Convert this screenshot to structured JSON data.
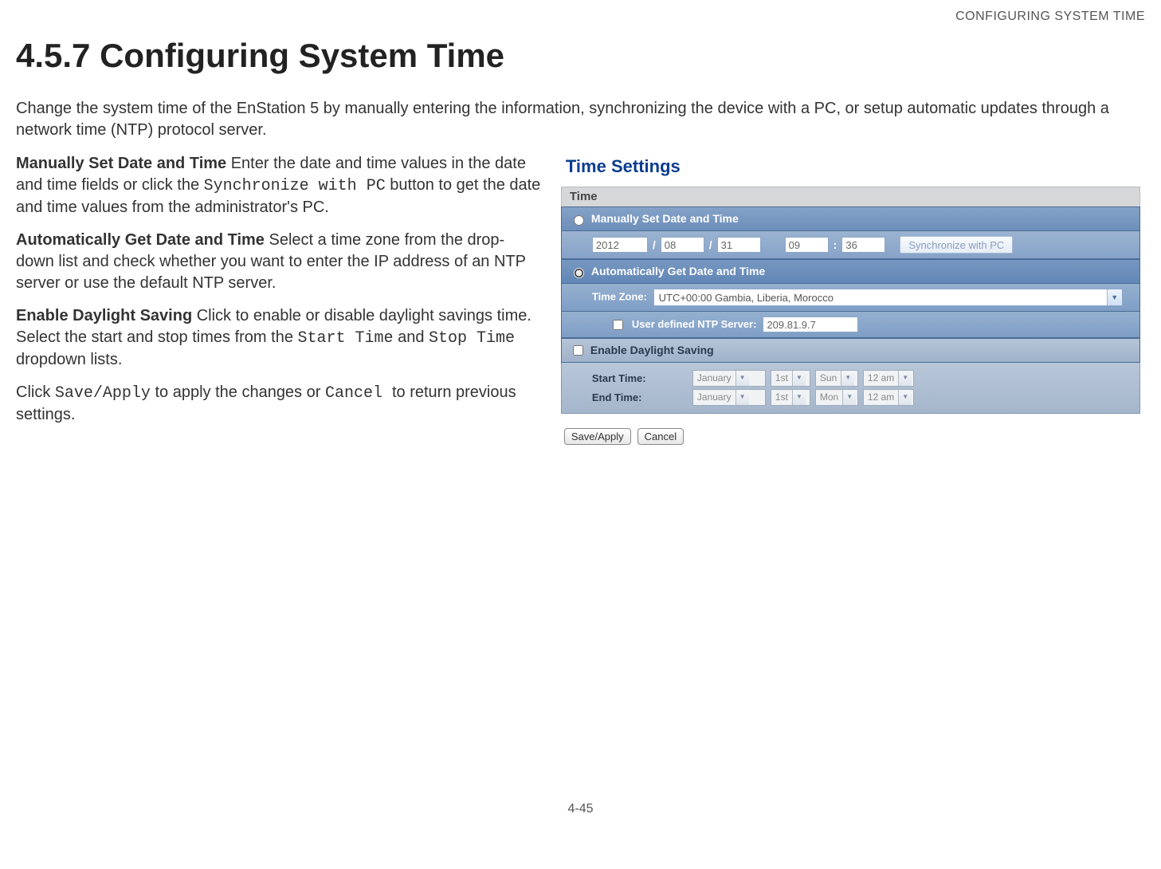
{
  "running_header": "CONFIGURING SYSTEM TIME",
  "section_number_title": "4.5.7 Configuring System Time",
  "intro": "Change the system time of the EnStation 5 by manually entering the information, synchronizing the device with a PC, or setup automatic updates through a network time (NTP) protocol server.",
  "p1": {
    "lead": "Manually Set Date and Time",
    "a": "  Enter the date and time values in the date and time fields or click the ",
    "code": "Synchronize with PC",
    "b": " button to get the date and time values from the administrator's PC."
  },
  "p2": {
    "lead": "Automatically Get Date and Time",
    "a": "  Select a time zone from the drop-down list and check whether you want to enter the IP address of an NTP server or use the default NTP server."
  },
  "p3": {
    "lead": "Enable Daylight Saving",
    "a": "  Click to enable or disable daylight savings time. Select the start and stop times from the ",
    "code1": "Start Time",
    "mid": " and ",
    "code2": "Stop Time",
    "b": " dropdown lists."
  },
  "p4": {
    "a": "Click ",
    "code1": "Save/Apply",
    "mid": " to apply the changes or ",
    "code2": "Cancel ",
    "b": " to return previous settings."
  },
  "panel": {
    "title": "Time Settings",
    "time_header": "Time",
    "manual": {
      "label": "Manually Set Date and Time",
      "year": "2012",
      "month": "08",
      "day": "31",
      "hour": "09",
      "minute": "36",
      "sync_btn": "Synchronize with PC",
      "slash": "/",
      "colon": ":"
    },
    "auto": {
      "label": "Automatically Get Date and Time",
      "tz_label": "Time Zone:",
      "tz_value": "UTC+00:00 Gambia, Liberia, Morocco",
      "ntp_label": "User defined NTP Server:",
      "ntp_value": "209.81.9.7"
    },
    "dls": {
      "label": "Enable Daylight Saving",
      "start_label": "Start Time:",
      "end_label": "End Time:",
      "start": {
        "month": "January",
        "date": "1st",
        "day": "Sun",
        "hour": "12 am"
      },
      "end": {
        "month": "January",
        "date": "1st",
        "day": "Mon",
        "hour": "12 am"
      }
    },
    "save_btn": "Save/Apply",
    "cancel_btn": "Cancel"
  },
  "page_num": "4-45"
}
